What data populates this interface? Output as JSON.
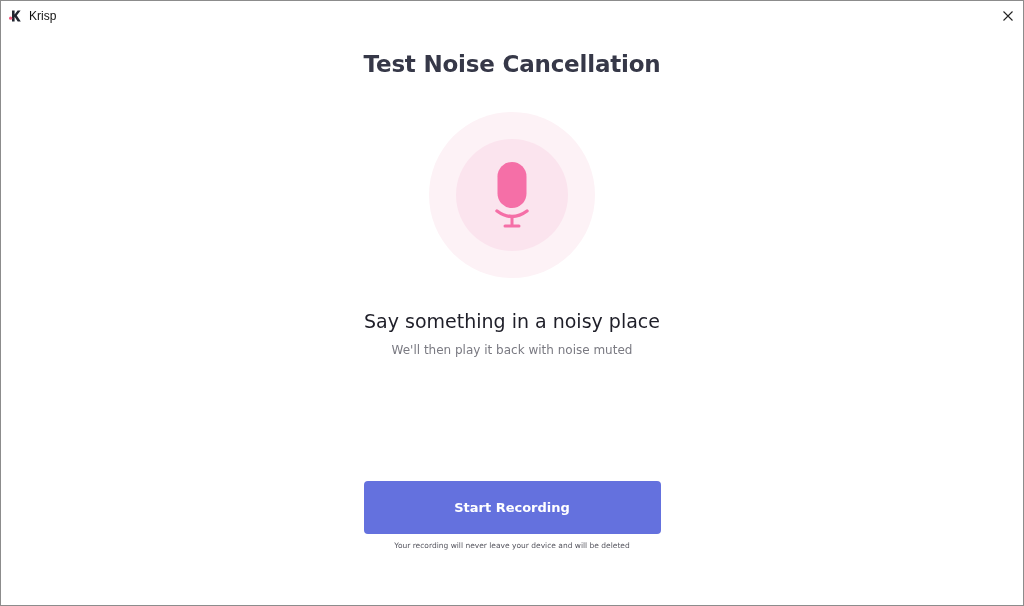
{
  "window": {
    "title": "Krisp"
  },
  "heading": "Test Noise Cancellation",
  "prompt": {
    "title": "Say something in a noisy place",
    "subtitle": "We'll then play it back with noise muted"
  },
  "button": {
    "label": "Start Recording"
  },
  "note": "Your recording will never leave your device and will be deleted"
}
